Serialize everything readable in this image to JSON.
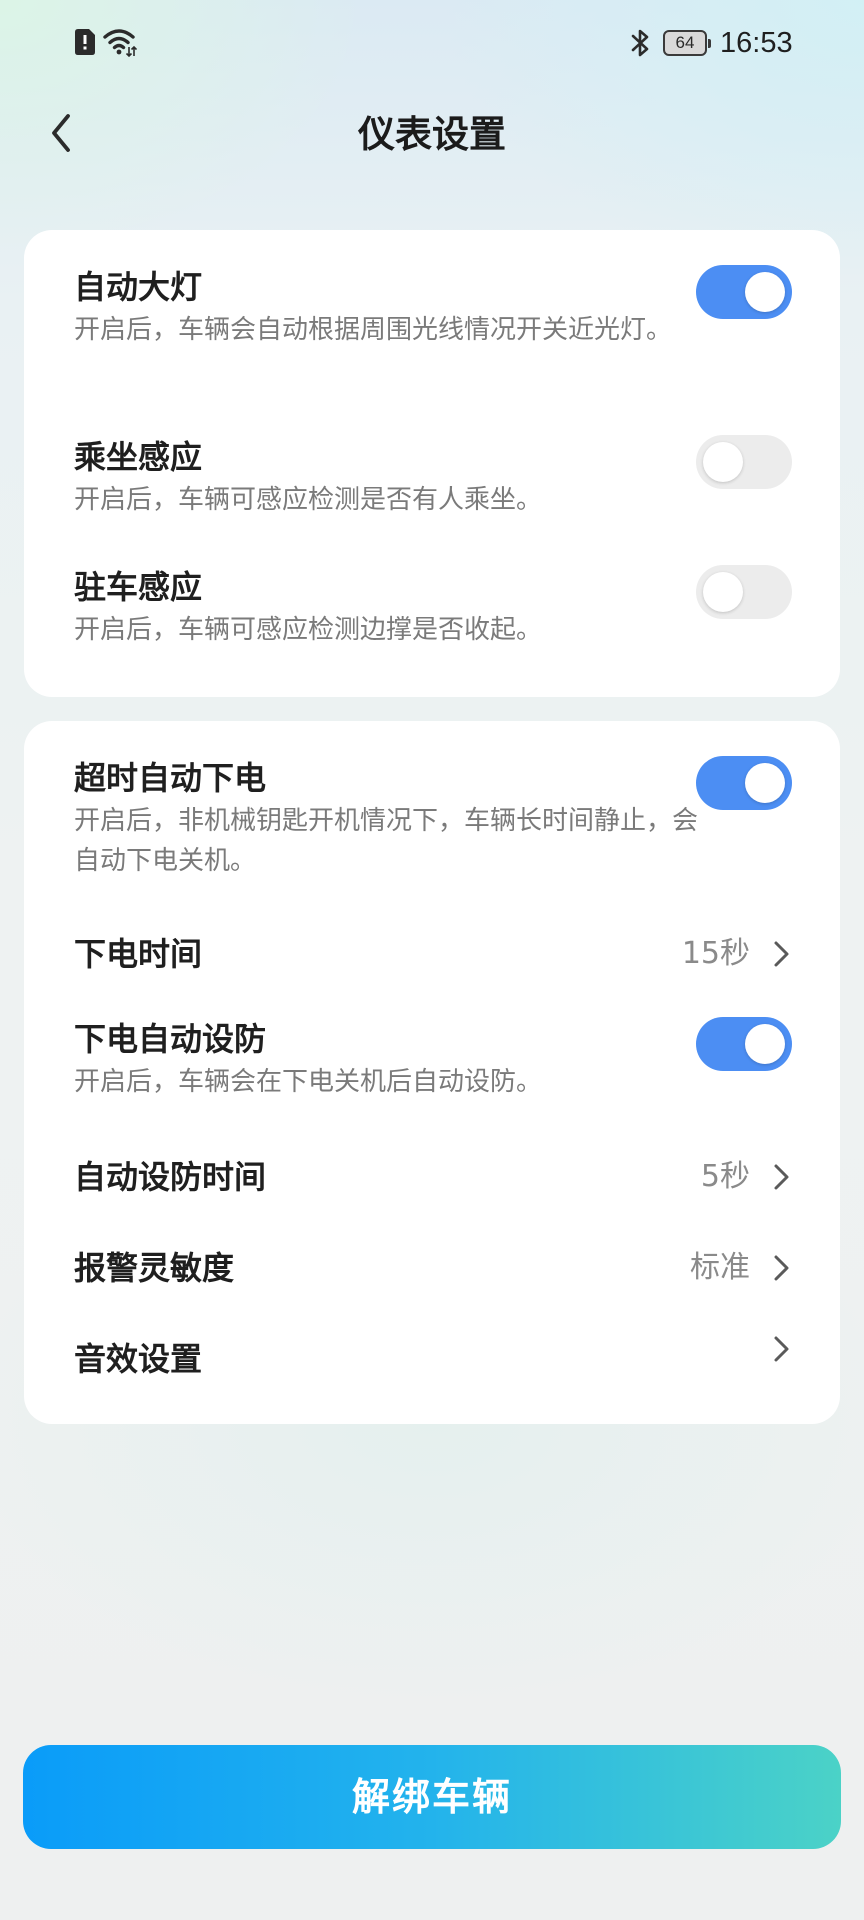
{
  "status_bar": {
    "time": "16:53",
    "battery_level": "64",
    "icons": [
      "sim-alert-icon",
      "wifi-icon",
      "bluetooth-icon",
      "battery-icon"
    ]
  },
  "header": {
    "title": "仪表设置",
    "back_icon": "chevron-left-icon"
  },
  "card1": {
    "items": [
      {
        "title": "自动大灯",
        "description": "开启后，车辆会自动根据周围光线情况开关近光灯。",
        "toggle_on": true
      },
      {
        "title": "乘坐感应",
        "description": "开启后，车辆可感应检测是否有人乘坐。",
        "toggle_on": false
      },
      {
        "title": "驻车感应",
        "description": "开启后，车辆可感应检测边撑是否收起。",
        "toggle_on": false
      }
    ]
  },
  "card2": {
    "auto_power_off": {
      "title": "超时自动下电",
      "description": "开启后，非机械钥匙开机情况下，车辆长时间静止，会自动下电关机。",
      "toggle_on": true
    },
    "power_off_time": {
      "title": "下电时间",
      "value": "15秒"
    },
    "power_off_arm": {
      "title": "下电自动设防",
      "description": "开启后，车辆会在下电关机后自动设防。",
      "toggle_on": true
    },
    "auto_arm_time": {
      "title": "自动设防时间",
      "value": "5秒"
    },
    "alarm_sensitivity": {
      "title": "报警灵敏度",
      "value": "标准"
    },
    "sound_settings": {
      "title": "音效设置"
    }
  },
  "footer": {
    "unbind_label": "解绑车辆"
  },
  "colors": {
    "toggle_on": "#4c8ef3",
    "toggle_off": "#ececec",
    "button_gradient_start": "#0a9cf9",
    "button_gradient_end": "#4bd2c7"
  }
}
